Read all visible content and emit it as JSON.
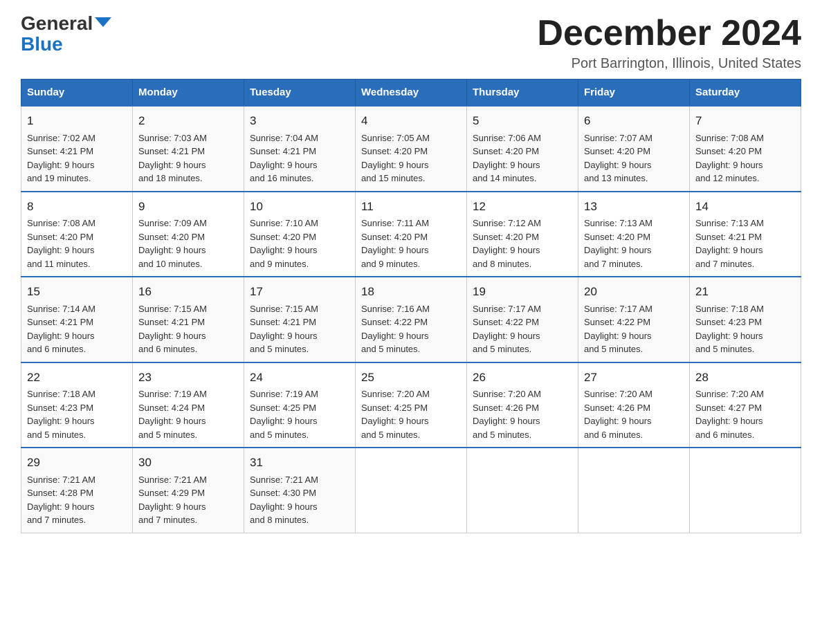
{
  "logo": {
    "general": "General",
    "blue": "Blue"
  },
  "title": "December 2024",
  "subtitle": "Port Barrington, Illinois, United States",
  "days_of_week": [
    "Sunday",
    "Monday",
    "Tuesday",
    "Wednesday",
    "Thursday",
    "Friday",
    "Saturday"
  ],
  "weeks": [
    [
      {
        "date": "1",
        "sunrise": "7:02 AM",
        "sunset": "4:21 PM",
        "daylight": "9 hours and 19 minutes."
      },
      {
        "date": "2",
        "sunrise": "7:03 AM",
        "sunset": "4:21 PM",
        "daylight": "9 hours and 18 minutes."
      },
      {
        "date": "3",
        "sunrise": "7:04 AM",
        "sunset": "4:21 PM",
        "daylight": "9 hours and 16 minutes."
      },
      {
        "date": "4",
        "sunrise": "7:05 AM",
        "sunset": "4:20 PM",
        "daylight": "9 hours and 15 minutes."
      },
      {
        "date": "5",
        "sunrise": "7:06 AM",
        "sunset": "4:20 PM",
        "daylight": "9 hours and 14 minutes."
      },
      {
        "date": "6",
        "sunrise": "7:07 AM",
        "sunset": "4:20 PM",
        "daylight": "9 hours and 13 minutes."
      },
      {
        "date": "7",
        "sunrise": "7:08 AM",
        "sunset": "4:20 PM",
        "daylight": "9 hours and 12 minutes."
      }
    ],
    [
      {
        "date": "8",
        "sunrise": "7:08 AM",
        "sunset": "4:20 PM",
        "daylight": "9 hours and 11 minutes."
      },
      {
        "date": "9",
        "sunrise": "7:09 AM",
        "sunset": "4:20 PM",
        "daylight": "9 hours and 10 minutes."
      },
      {
        "date": "10",
        "sunrise": "7:10 AM",
        "sunset": "4:20 PM",
        "daylight": "9 hours and 9 minutes."
      },
      {
        "date": "11",
        "sunrise": "7:11 AM",
        "sunset": "4:20 PM",
        "daylight": "9 hours and 9 minutes."
      },
      {
        "date": "12",
        "sunrise": "7:12 AM",
        "sunset": "4:20 PM",
        "daylight": "9 hours and 8 minutes."
      },
      {
        "date": "13",
        "sunrise": "7:13 AM",
        "sunset": "4:20 PM",
        "daylight": "9 hours and 7 minutes."
      },
      {
        "date": "14",
        "sunrise": "7:13 AM",
        "sunset": "4:21 PM",
        "daylight": "9 hours and 7 minutes."
      }
    ],
    [
      {
        "date": "15",
        "sunrise": "7:14 AM",
        "sunset": "4:21 PM",
        "daylight": "9 hours and 6 minutes."
      },
      {
        "date": "16",
        "sunrise": "7:15 AM",
        "sunset": "4:21 PM",
        "daylight": "9 hours and 6 minutes."
      },
      {
        "date": "17",
        "sunrise": "7:15 AM",
        "sunset": "4:21 PM",
        "daylight": "9 hours and 5 minutes."
      },
      {
        "date": "18",
        "sunrise": "7:16 AM",
        "sunset": "4:22 PM",
        "daylight": "9 hours and 5 minutes."
      },
      {
        "date": "19",
        "sunrise": "7:17 AM",
        "sunset": "4:22 PM",
        "daylight": "9 hours and 5 minutes."
      },
      {
        "date": "20",
        "sunrise": "7:17 AM",
        "sunset": "4:22 PM",
        "daylight": "9 hours and 5 minutes."
      },
      {
        "date": "21",
        "sunrise": "7:18 AM",
        "sunset": "4:23 PM",
        "daylight": "9 hours and 5 minutes."
      }
    ],
    [
      {
        "date": "22",
        "sunrise": "7:18 AM",
        "sunset": "4:23 PM",
        "daylight": "9 hours and 5 minutes."
      },
      {
        "date": "23",
        "sunrise": "7:19 AM",
        "sunset": "4:24 PM",
        "daylight": "9 hours and 5 minutes."
      },
      {
        "date": "24",
        "sunrise": "7:19 AM",
        "sunset": "4:25 PM",
        "daylight": "9 hours and 5 minutes."
      },
      {
        "date": "25",
        "sunrise": "7:20 AM",
        "sunset": "4:25 PM",
        "daylight": "9 hours and 5 minutes."
      },
      {
        "date": "26",
        "sunrise": "7:20 AM",
        "sunset": "4:26 PM",
        "daylight": "9 hours and 5 minutes."
      },
      {
        "date": "27",
        "sunrise": "7:20 AM",
        "sunset": "4:26 PM",
        "daylight": "9 hours and 6 minutes."
      },
      {
        "date": "28",
        "sunrise": "7:20 AM",
        "sunset": "4:27 PM",
        "daylight": "9 hours and 6 minutes."
      }
    ],
    [
      {
        "date": "29",
        "sunrise": "7:21 AM",
        "sunset": "4:28 PM",
        "daylight": "9 hours and 7 minutes."
      },
      {
        "date": "30",
        "sunrise": "7:21 AM",
        "sunset": "4:29 PM",
        "daylight": "9 hours and 7 minutes."
      },
      {
        "date": "31",
        "sunrise": "7:21 AM",
        "sunset": "4:30 PM",
        "daylight": "9 hours and 8 minutes."
      },
      null,
      null,
      null,
      null
    ]
  ],
  "labels": {
    "sunrise": "Sunrise:",
    "sunset": "Sunset:",
    "daylight": "Daylight:"
  }
}
